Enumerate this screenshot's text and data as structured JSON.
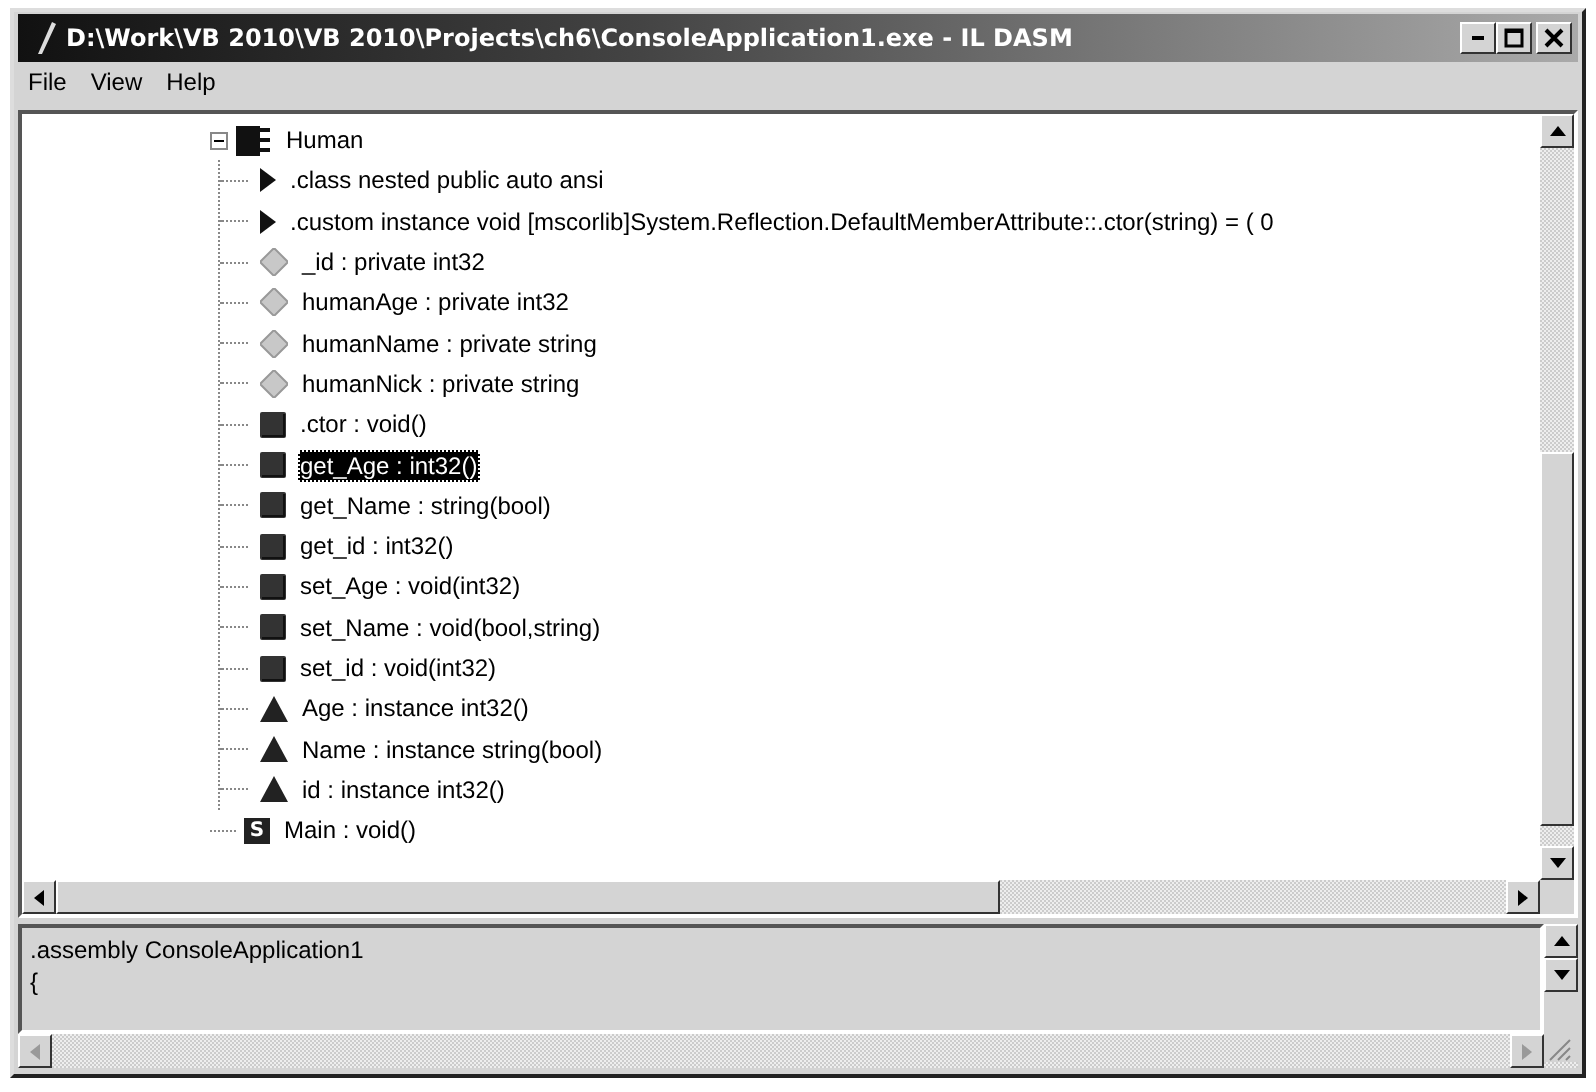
{
  "window": {
    "title": "D:\\Work\\VB 2010\\VB 2010\\Projects\\ch6\\ConsoleApplication1.exe - IL DASM"
  },
  "menu": [
    {
      "label": "File"
    },
    {
      "label": "View"
    },
    {
      "label": "Help"
    }
  ],
  "tree": [
    {
      "label": "Human",
      "kind": "class",
      "expanded": true,
      "selected": false,
      "children": [
        {
          "label": ".class nested public auto ansi",
          "kind": "attribute",
          "selected": false
        },
        {
          "label": ".custom instance void [mscorlib]System.Reflection.DefaultMemberAttribute::.ctor(string) = ( 0",
          "kind": "attribute",
          "selected": false
        },
        {
          "label": "_id : private int32",
          "kind": "field",
          "selected": false
        },
        {
          "label": "humanAge : private int32",
          "kind": "field",
          "selected": false
        },
        {
          "label": "humanName : private string",
          "kind": "field",
          "selected": false
        },
        {
          "label": "humanNick : private string",
          "kind": "field",
          "selected": false
        },
        {
          "label": ".ctor : void()",
          "kind": "method",
          "selected": false
        },
        {
          "label": "get_Age : int32()",
          "kind": "method",
          "selected": true
        },
        {
          "label": "get_Name : string(bool)",
          "kind": "method",
          "selected": false
        },
        {
          "label": "get_id : int32()",
          "kind": "method",
          "selected": false
        },
        {
          "label": "set_Age : void(int32)",
          "kind": "method",
          "selected": false
        },
        {
          "label": "set_Name : void(bool,string)",
          "kind": "method",
          "selected": false
        },
        {
          "label": "set_id : void(int32)",
          "kind": "method",
          "selected": false
        },
        {
          "label": "Age : instance int32()",
          "kind": "property",
          "selected": false
        },
        {
          "label": "Name : instance string(bool)",
          "kind": "property",
          "selected": false
        },
        {
          "label": "id : instance int32()",
          "kind": "property",
          "selected": false
        }
      ]
    },
    {
      "label": "Main : void()",
      "kind": "static",
      "badge": "S",
      "selected": false
    }
  ],
  "output": {
    "lines": [
      ".assembly ConsoleApplication1",
      "{"
    ]
  }
}
